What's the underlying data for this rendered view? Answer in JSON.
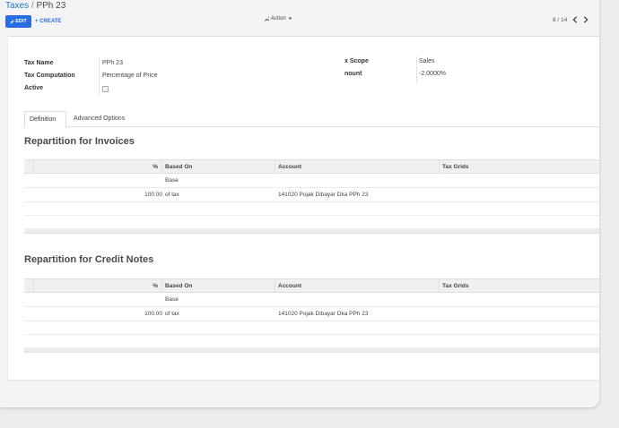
{
  "breadcrumb": {
    "parent": "Taxes",
    "separator": "/",
    "current": "PPh 23"
  },
  "toolbar": {
    "edit_label": "EDIT",
    "create_label": "+ CREATE",
    "action_label": "Action",
    "pager_text": "8 / 14"
  },
  "form": {
    "tax_name_label": "Tax Name",
    "tax_name_value": "PPh 23",
    "tax_computation_label": "Tax Computation",
    "tax_computation_value": "Percentage of Price",
    "active_label": "Active",
    "active_checked": false,
    "tax_scope_label": "x Scope",
    "tax_scope_value": "Sales",
    "amount_label": "nount",
    "amount_value": "-2.0000%"
  },
  "tabs": [
    {
      "label": "Definition",
      "active": true
    },
    {
      "label": "Advanced Options",
      "active": false
    }
  ],
  "invoices": {
    "title": "Repartition for Invoices",
    "headers": {
      "pct": "%",
      "based_on": "Based On",
      "account": "Account",
      "tax_grids": "Tax Grids"
    },
    "rows": [
      {
        "pct": "",
        "based_on": "Base",
        "account": "",
        "tax_grids": ""
      },
      {
        "pct": "100.00",
        "based_on": "of tax",
        "account": "141020 Pojak Dibayar Dka PPh 23",
        "tax_grids": ""
      }
    ]
  },
  "credit_notes": {
    "title": "Repartition for Credit Notes",
    "headers": {
      "pct": "%",
      "based_on": "Based On",
      "account": "Account",
      "tax_grids": "Tax Grids"
    },
    "rows": [
      {
        "pct": "",
        "based_on": "Base",
        "account": "",
        "tax_grids": ""
      },
      {
        "pct": "100.00",
        "based_on": "of tax",
        "account": "141020 Pojak Dibayar Dka PPh 23",
        "tax_grids": ""
      }
    ]
  },
  "colors": {
    "primary": "#2a6de0",
    "link": "#1a73c9",
    "header_bg": "#eef0f2"
  }
}
